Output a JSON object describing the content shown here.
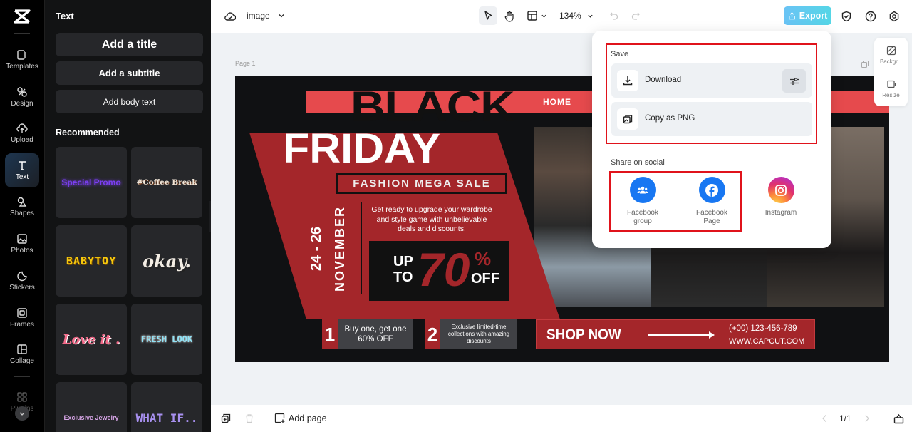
{
  "rail": {
    "items": [
      {
        "label": "Templates",
        "icon": "templates-icon"
      },
      {
        "label": "Design",
        "icon": "design-icon"
      },
      {
        "label": "Upload",
        "icon": "upload-icon"
      },
      {
        "label": "Text",
        "icon": "text-icon",
        "active": true
      },
      {
        "label": "Shapes",
        "icon": "shapes-icon"
      },
      {
        "label": "Photos",
        "icon": "photos-icon"
      },
      {
        "label": "Stickers",
        "icon": "stickers-icon"
      },
      {
        "label": "Frames",
        "icon": "frames-icon"
      },
      {
        "label": "Collage",
        "icon": "collage-icon"
      },
      {
        "label": "Plugins",
        "icon": "plugins-icon"
      }
    ]
  },
  "panel": {
    "title": "Text",
    "add_title": "Add a title",
    "add_subtitle": "Add a subtitle",
    "add_body": "Add body text",
    "recommended": "Recommended",
    "presets": [
      {
        "label": "Special Promo",
        "color": "#7b3ff2"
      },
      {
        "label": "#Coffee Break",
        "color": "#f1e6d8"
      },
      {
        "label": "BABYTOY",
        "color": "#f6c90e"
      },
      {
        "label": "okay.",
        "color": "#f3ede4"
      },
      {
        "label": "Love it .",
        "color": "#f26b8a"
      },
      {
        "label": "FRESH LOOK",
        "color": "#8fe3f6"
      },
      {
        "label": "Exclusive Jewelry",
        "color": "#d8a6e8"
      },
      {
        "label": "WHAT IF..",
        "color": "#a890f0"
      }
    ]
  },
  "topbar": {
    "doc_name": "image",
    "zoom": "134%",
    "export_label": "Export",
    "export_color": "#5ccbee"
  },
  "canvas": {
    "page_label": "Page 1",
    "design": {
      "home": "HOME",
      "black": "BLACK",
      "friday": "FRIDAY",
      "tagline": "FASHION MEGA SALE",
      "dates": "24 - 26",
      "month": "NOVEMBER",
      "blurb": "Get ready to upgrade your wardrobe and style game with unbelievable deals and discounts!",
      "up_to": "UP TO",
      "percent_value": "70",
      "percent_sign": "%",
      "off": "OFF",
      "benefit1_num": "1",
      "benefit1_text": "Buy one, get one 60% OFF",
      "benefit2_num": "2",
      "benefit2_text": "Exclusive limited-time collections with amazing discounts",
      "shop_now": "SHOP NOW",
      "phone": "(+00) 123-456-789",
      "website": "WWW.CAPCUT.COM",
      "accent_red": "#a4262a",
      "accent_coral": "#e64a4d"
    }
  },
  "side_tools": {
    "background": "Backgr...",
    "resize": "Resize"
  },
  "export_menu": {
    "save_label": "Save",
    "download": "Download",
    "copy_png": "Copy as PNG",
    "share_label": "Share on social",
    "social": [
      {
        "label": "Facebook group",
        "color": "#1877f2"
      },
      {
        "label": "Facebook Page",
        "color": "#1877f2"
      },
      {
        "label": "Instagram",
        "color": "#e1306c"
      }
    ],
    "highlight_color": "#e0131b"
  },
  "bottombar": {
    "add_page": "Add page",
    "pager": "1/1"
  }
}
